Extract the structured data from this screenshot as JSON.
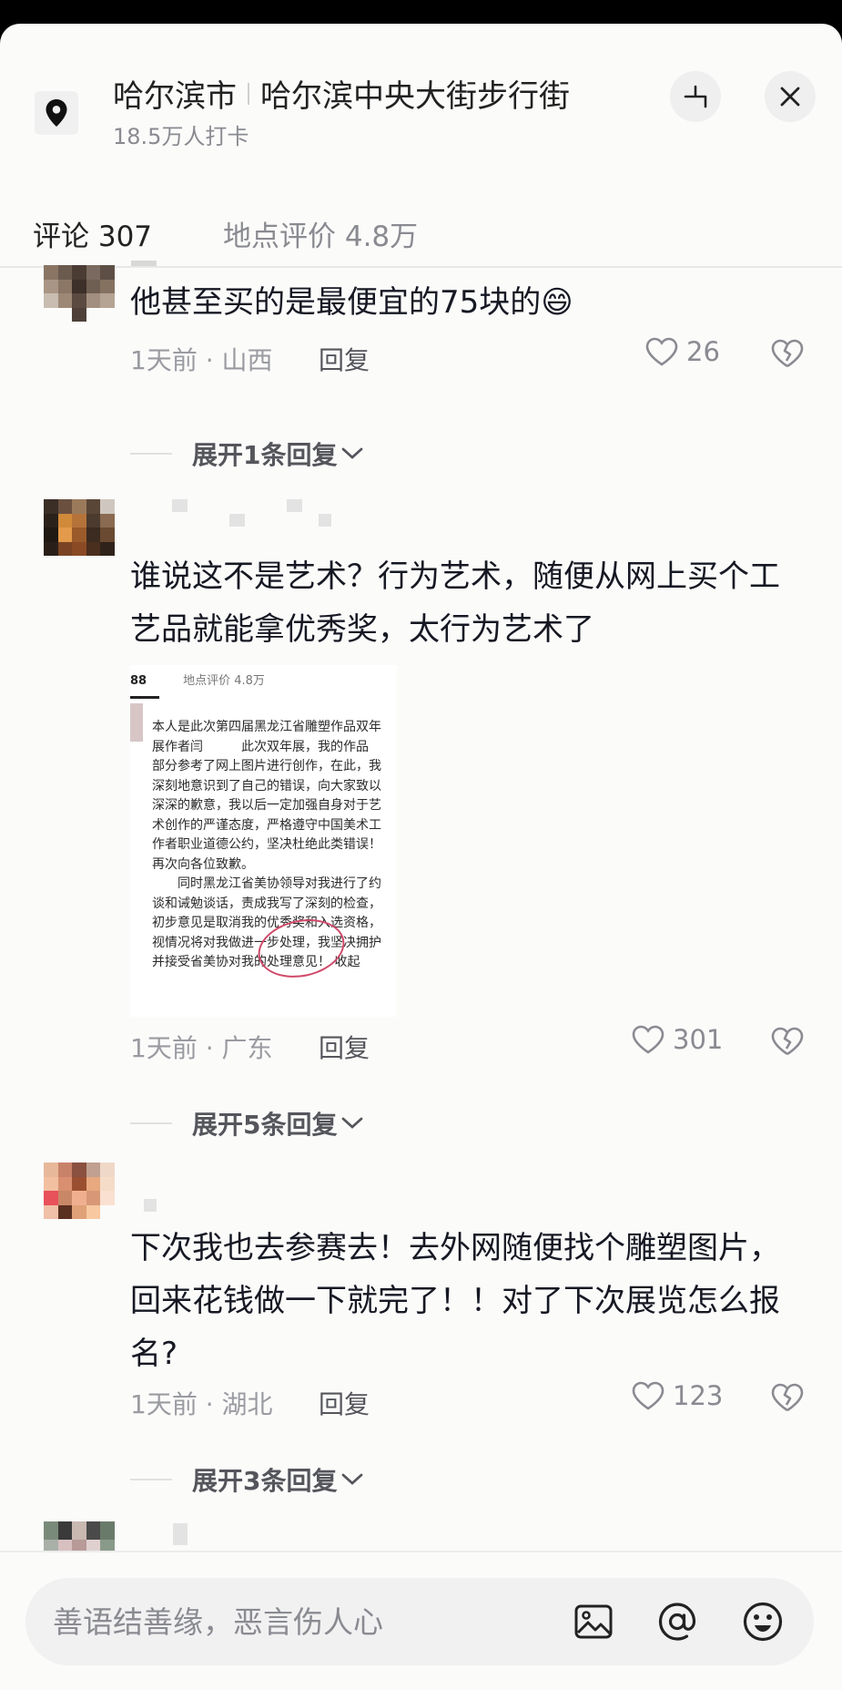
{
  "header": {
    "city": "哈尔滨市",
    "place": "哈尔滨中央大街步行街",
    "checkins": "18.5万人打卡"
  },
  "tabs": [
    {
      "label": "评论 307"
    },
    {
      "label": "地点评价 4.8万"
    }
  ],
  "comments": [
    {
      "text": "他甚至买的是最便宜的75块的😄",
      "meta": "1天前 · 山西",
      "reply_label": "回复",
      "likes": "26",
      "expand_label": "展开1条回复"
    },
    {
      "text": "谁说这不是艺术？行为艺术，随便从网上买个工艺品就能拿优秀奖，太行为艺术了",
      "meta": "1天前 · 广东",
      "reply_label": "回复",
      "likes": "301",
      "expand_label": "展开5条回复",
      "image": {
        "top_left": "88",
        "top_tab": "地点评价 4.8万",
        "text": "本人是此次第四届黑龙江省雕塑作品双年\n展作者闫　　　此次双年展，我的作品\n部分参考了网上图片进行创作，在此，我\n深刻地意识到了自己的错误，向大家致以\n深深的歉意，我以后一定加强自身对于艺\n术创作的严谨态度，严格遵守中国美术工\n作者职业道德公约，坚决杜绝此类错误！\n再次向各位致歉。\n　　同时黑龙江省美协领导对我进行了约\n谈和诫勉谈话，责成我写了深刻的检查，\n初步意见是取消我的优秀奖和入选资格，\n视情况将对我做进一步处理，我坚决拥护\n并接受省美协对我的处理意见！ 收起"
      }
    },
    {
      "text": "下次我也去参赛去！去外网随便找个雕塑图片，回来花钱做一下就完了！！对了下次展览怎么报名?",
      "meta": "1天前 · 湖北",
      "reply_label": "回复",
      "likes": "123",
      "expand_label": "展开3条回复"
    }
  ],
  "input": {
    "placeholder": "善语结善缘，恶言伤人心"
  },
  "colors": {
    "background": "#fbfbfa",
    "text": "#161823",
    "muted": "#8a8b91",
    "circle": "#d04a6a"
  }
}
